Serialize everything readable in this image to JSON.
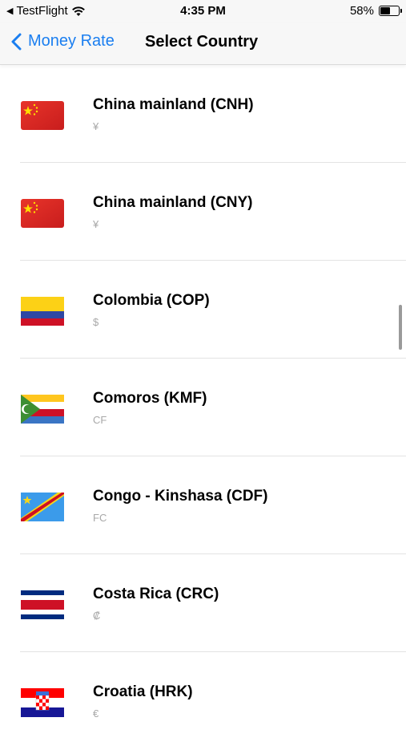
{
  "status_bar": {
    "back_app": "TestFlight",
    "time": "4:35 PM",
    "battery": "58%",
    "battery_level": 0.58
  },
  "nav": {
    "back_label": "Money Rate",
    "title": "Select Country"
  },
  "countries": [
    {
      "name": "China mainland (CNH)",
      "symbol": "¥",
      "flag": "china"
    },
    {
      "name": "China mainland (CNY)",
      "symbol": "¥",
      "flag": "china"
    },
    {
      "name": "Colombia (COP)",
      "symbol": "$",
      "flag": "colombia"
    },
    {
      "name": "Comoros (KMF)",
      "symbol": "CF",
      "flag": "comoros"
    },
    {
      "name": "Congo - Kinshasa (CDF)",
      "symbol": "FC",
      "flag": "congo-kinshasa"
    },
    {
      "name": "Costa Rica (CRC)",
      "symbol": "₡",
      "flag": "costa-rica"
    },
    {
      "name": "Croatia (HRK)",
      "symbol": "€",
      "flag": "croatia"
    }
  ]
}
